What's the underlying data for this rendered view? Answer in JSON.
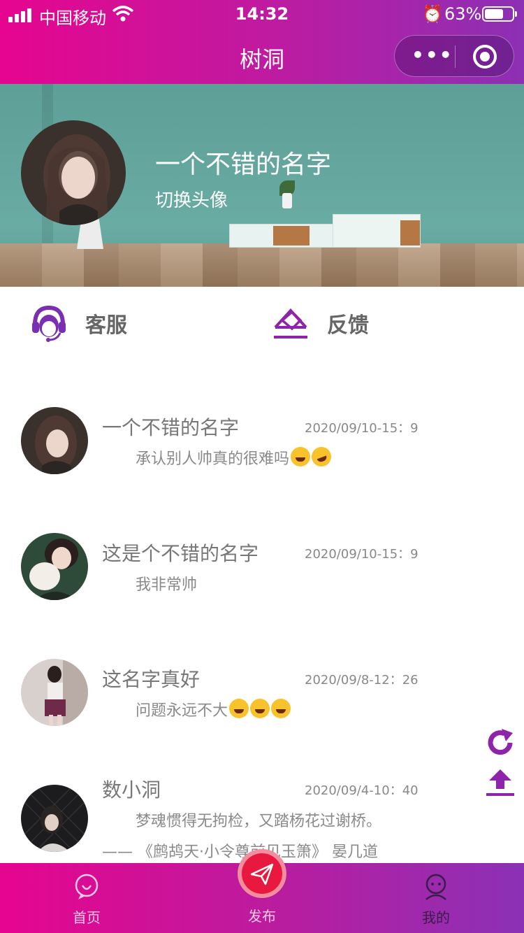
{
  "status_bar": {
    "carrier": "中国移动",
    "time": "14:32",
    "battery": "63%"
  },
  "nav": {
    "title": "树洞",
    "more_icon": "more-dots-icon",
    "close_icon": "target-circle-icon"
  },
  "profile": {
    "nickname": "一个不错的名字",
    "switch_avatar": "切换头像"
  },
  "actions": {
    "service": "客服",
    "feedback": "反馈"
  },
  "posts": [
    {
      "name": "一个不错的名字",
      "time": "2020/09/10-15：9",
      "content": "承认别人帅真的很难吗",
      "emojis": [
        "joy",
        "rofl"
      ]
    },
    {
      "name": "这是个不错的名字",
      "time": "2020/09/10-15：9",
      "content": "我非常帅",
      "emojis": []
    },
    {
      "name": "这名字真好",
      "time": "2020/09/8-12：26",
      "content": "问题永远不大",
      "emojis": [
        "joy",
        "joy",
        "joy"
      ]
    },
    {
      "name": "数小洞",
      "time": "2020/09/4-10：40",
      "content": "梦魂惯得无拘检，又踏杨花过谢桥。",
      "extra": "—— 《鹧鸪天·小令尊前见玉箫》 晏几道",
      "emojis": []
    }
  ],
  "float_buttons": {
    "refresh": "refresh-icon",
    "top": "upload-icon"
  },
  "tabbar": {
    "home": "首页",
    "publish": "发布",
    "mine": "我的"
  },
  "colors": {
    "accent": "#e6058f",
    "accent_end": "#8c30b4",
    "purple": "#8e24aa",
    "publish": "#e8183f"
  }
}
